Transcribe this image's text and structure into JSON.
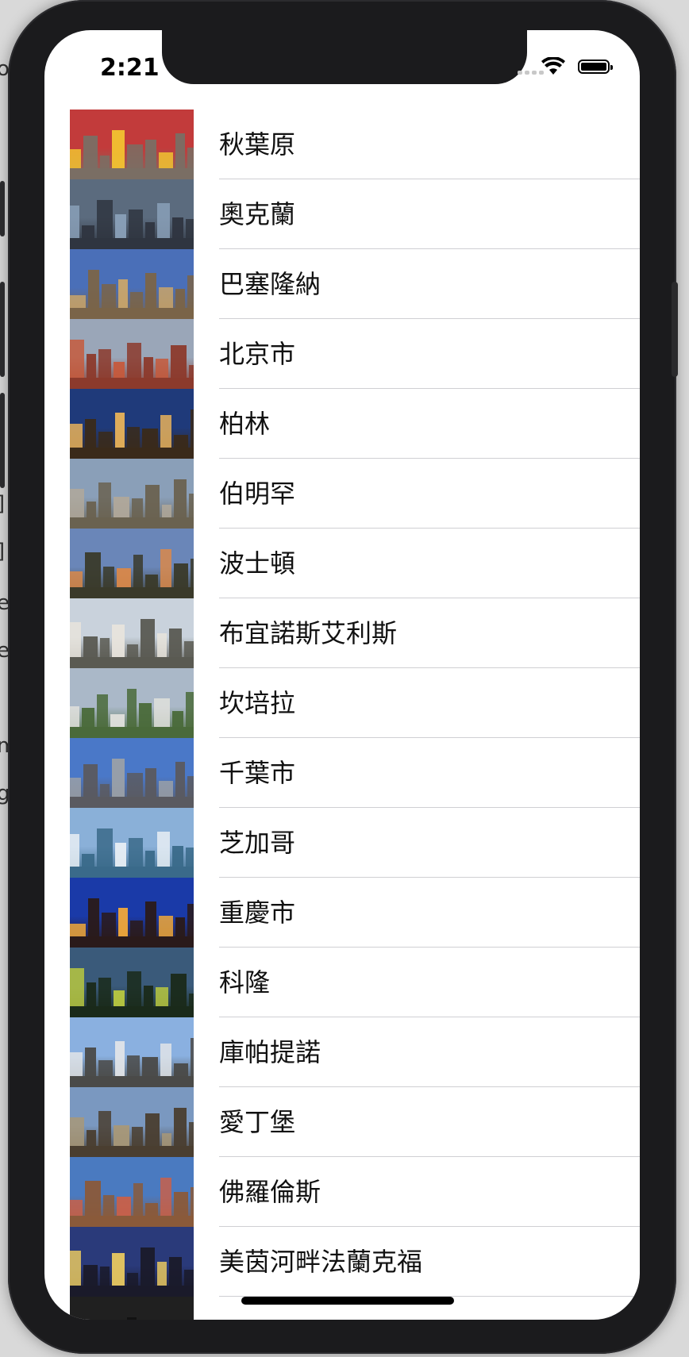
{
  "status_bar": {
    "time": "2:21"
  },
  "cities": [
    {
      "name": "秋葉原",
      "sky": "#c23b3b",
      "ground": "#7a6e64",
      "accent": "#f2c230"
    },
    {
      "name": "奧克蘭",
      "sky": "#5b6b7e",
      "ground": "#2f3540",
      "accent": "#8aa0b8"
    },
    {
      "name": "巴塞隆納",
      "sky": "#4a6fb8",
      "ground": "#7a6448",
      "accent": "#c9a56a"
    },
    {
      "name": "北京市",
      "sky": "#9aa6b8",
      "ground": "#8c3a2c",
      "accent": "#c55a3c"
    },
    {
      "name": "柏林",
      "sky": "#1f3a7a",
      "ground": "#3a2a1a",
      "accent": "#e8b25a"
    },
    {
      "name": "伯明罕",
      "sky": "#8a9fb8",
      "ground": "#6a6250",
      "accent": "#b0a89a"
    },
    {
      "name": "波士頓",
      "sky": "#6a86b8",
      "ground": "#3a3a2a",
      "accent": "#d9884a"
    },
    {
      "name": "布宜諾斯艾利斯",
      "sky": "#c9d2dc",
      "ground": "#5a5a52",
      "accent": "#e8e4dc"
    },
    {
      "name": "坎培拉",
      "sky": "#aab8c8",
      "ground": "#4a6a3a",
      "accent": "#e0e0dc"
    },
    {
      "name": "千葉市",
      "sky": "#4a78c8",
      "ground": "#5a5a60",
      "accent": "#9aa0a8"
    },
    {
      "name": "芝加哥",
      "sky": "#8ab0d8",
      "ground": "#3a6a8a",
      "accent": "#e8eef4"
    },
    {
      "name": "重慶市",
      "sky": "#1a3aa8",
      "ground": "#2a1a1a",
      "accent": "#f0a83a"
    },
    {
      "name": "科隆",
      "sky": "#3a5a7a",
      "ground": "#1a2a1a",
      "accent": "#b8c840"
    },
    {
      "name": "庫帕提諾",
      "sky": "#8ab0e0",
      "ground": "#4a4a48",
      "accent": "#e0e4e8"
    },
    {
      "name": "愛丁堡",
      "sky": "#7a98c0",
      "ground": "#4a3e30",
      "accent": "#a89878"
    },
    {
      "name": "佛羅倫斯",
      "sky": "#4a7ac0",
      "ground": "#8a5a3a",
      "accent": "#c8604a"
    },
    {
      "name": "美茵河畔法蘭克福",
      "sky": "#2a3a7a",
      "ground": "#1a1a2a",
      "accent": "#e8c860"
    },
    {
      "name": "",
      "sky": "#202020",
      "ground": "#101010",
      "accent": "#c0c0c0"
    }
  ]
}
